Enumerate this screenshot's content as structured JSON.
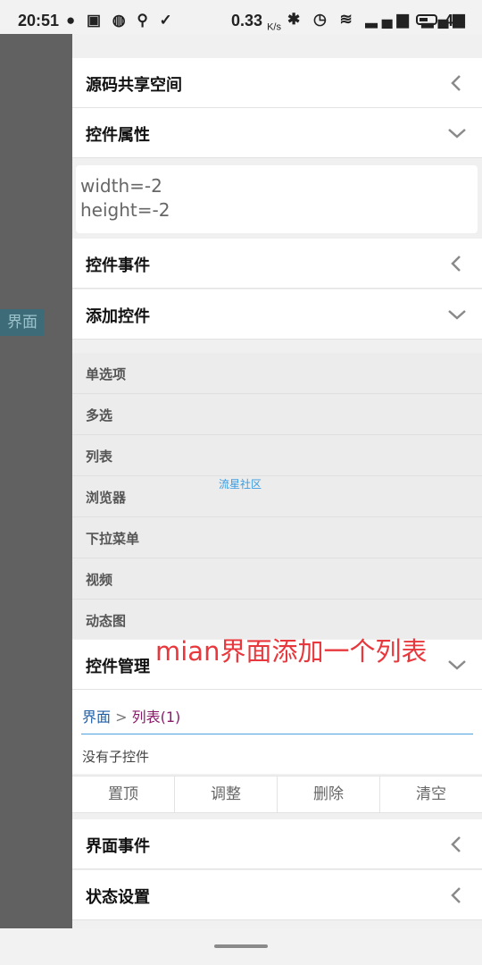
{
  "status_bar": {
    "time": "20:51",
    "left_icons": "● ▣ ◍ ⚲ ✓",
    "net_speed": "0.33",
    "net_unit": "K/s",
    "right_icons": "✱ ◷ ≋ ▂▄▆ ▂▄▆",
    "battery": "46"
  },
  "left_panel": {
    "tag": "界面"
  },
  "sections": {
    "source_share": "源码共享空间",
    "properties": "控件属性",
    "events": "控件事件",
    "add_control": "添加控件",
    "manage": "控件管理",
    "ui_events": "界面事件",
    "state": "状态设置"
  },
  "properties_box": {
    "line1": "width=-2",
    "line2": "height=-2"
  },
  "add_items": [
    "单选项",
    "多选",
    "列表",
    "浏览器",
    "下拉菜单",
    "视频",
    "动态图"
  ],
  "watermark": "流星社区",
  "annotation": "mian界面添加一个列表",
  "breadcrumb": {
    "root": "界面",
    "sep": " > ",
    "current": "列表(1)"
  },
  "no_child": "没有子控件",
  "actions": [
    "置顶",
    "调整",
    "删除",
    "清空"
  ],
  "colors": {
    "accent": "#4aa3df",
    "annotation": "#e8383d",
    "side": "#616161"
  }
}
